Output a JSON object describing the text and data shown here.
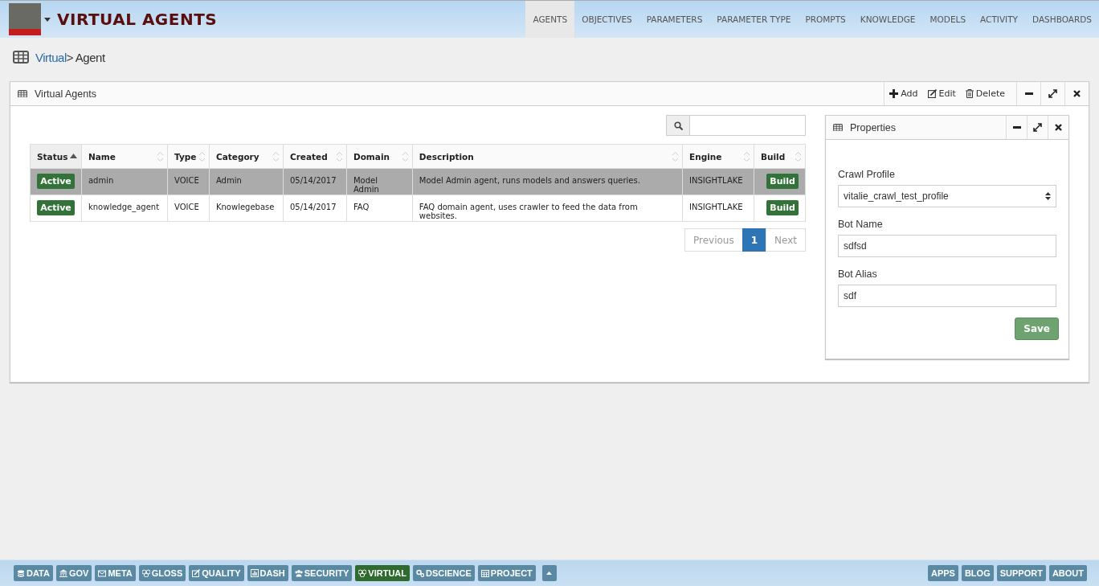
{
  "header": {
    "title": "VIRTUAL AGENTS",
    "nav": [
      {
        "label": "AGENTS",
        "selected": true
      },
      {
        "label": "OBJECTIVES",
        "selected": false
      },
      {
        "label": "PARAMETERS",
        "selected": false
      },
      {
        "label": "PARAMETER TYPE",
        "selected": false
      },
      {
        "label": "PROMPTS",
        "selected": false
      },
      {
        "label": "KNOWLEDGE",
        "selected": false
      },
      {
        "label": "MODELS",
        "selected": false
      },
      {
        "label": "ACTIVITY",
        "selected": false
      },
      {
        "label": "DASHBOARDS",
        "selected": false
      }
    ]
  },
  "breadcrumb": {
    "link": "Virtual",
    "current": "> Agent"
  },
  "panel": {
    "title": "Virtual Agents",
    "actions": [
      "Add",
      "Edit",
      "Delete"
    ],
    "table": {
      "columns": [
        {
          "label": "Status",
          "sorted": true
        },
        {
          "label": "Name",
          "sorted": false
        },
        {
          "label": "Type",
          "sorted": false
        },
        {
          "label": "Category",
          "sorted": false
        },
        {
          "label": "Created",
          "sorted": false
        },
        {
          "label": "Domain",
          "sorted": false
        },
        {
          "label": "Description",
          "sorted": false
        },
        {
          "label": "Engine",
          "sorted": false
        },
        {
          "label": "Build",
          "sorted": false
        }
      ],
      "rows": [
        {
          "selected": true,
          "status": "Active",
          "name": "admin",
          "type": "VOICE",
          "category": "Admin",
          "created": "05/14/2017",
          "domain": "Model Admin",
          "description": "Model Admin agent, runs models and answers queries.",
          "engine": "INSIGHTLAKE",
          "build": "Build"
        },
        {
          "selected": false,
          "status": "Active",
          "name": "knowledge_agent",
          "type": "VOICE",
          "category": "Knowlegebase",
          "created": "05/14/2017",
          "domain": "FAQ",
          "description": "FAQ domain agent, uses crawler to feed the data from websites.",
          "engine": "INSIGHTLAKE",
          "build": "Build"
        }
      ]
    },
    "pagination": [
      {
        "label": "Previous",
        "selected": false
      },
      {
        "label": "1",
        "selected": true
      },
      {
        "label": "Next",
        "selected": false
      }
    ]
  },
  "properties": {
    "title": "Properties",
    "crawl_profile": {
      "label": "Crawl Profile",
      "value": "vitalie_crawl_test_profile"
    },
    "bot_name": {
      "label": "Bot Name",
      "value": "sdfsd"
    },
    "bot_alias": {
      "label": "Bot Alias",
      "value": "sdf"
    },
    "save": "Save"
  },
  "footer": {
    "left": [
      {
        "label": "DATA",
        "selected": false
      },
      {
        "label": "GOV",
        "selected": false
      },
      {
        "label": "META",
        "selected": false
      },
      {
        "label": "GLOSS",
        "selected": false
      },
      {
        "label": "QUALITY",
        "selected": false
      },
      {
        "label": "DASH",
        "selected": false
      },
      {
        "label": "SECURITY",
        "selected": false
      },
      {
        "label": "VIRTUAL",
        "selected": true
      },
      {
        "label": "DSCIENCE",
        "selected": false
      },
      {
        "label": "PROJECT",
        "selected": false
      }
    ],
    "right": [
      "APPS",
      "BLOG",
      "SUPPORT",
      "ABOUT"
    ]
  }
}
